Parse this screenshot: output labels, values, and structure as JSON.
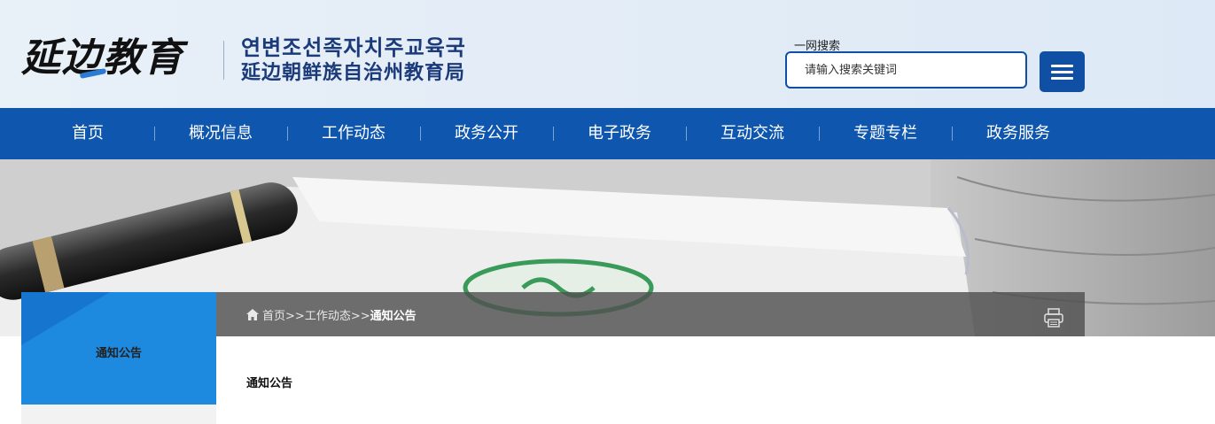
{
  "header": {
    "logo_calligraphy": "延边教育",
    "org_name_korean": "연변조선족자치주교육국",
    "org_name_chinese": "延边朝鲜族自治州教育局",
    "search_label": "一网搜索",
    "search_placeholder": "请输入搜索关键词",
    "menu_icon": "hamburger-menu-icon"
  },
  "nav": {
    "items": [
      {
        "label": "首页"
      },
      {
        "label": "概况信息"
      },
      {
        "label": "工作动态"
      },
      {
        "label": "政务公开"
      },
      {
        "label": "电子政务"
      },
      {
        "label": "互动交流"
      },
      {
        "label": "专题专栏"
      },
      {
        "label": "政务服务"
      }
    ]
  },
  "sidebar": {
    "title": "通知公告"
  },
  "breadcrumb": {
    "home_icon": "home-icon",
    "home": "首页",
    "sep1": ">>",
    "level1": "工作动态",
    "sep2": ">>",
    "current": "通知公告",
    "print_icon": "print-icon"
  },
  "content": {
    "title": "通知公告"
  },
  "colors": {
    "primary": "#0f56ae",
    "sidebar_blue": "#1d8ae0",
    "header_bg": "#e4edf7"
  }
}
